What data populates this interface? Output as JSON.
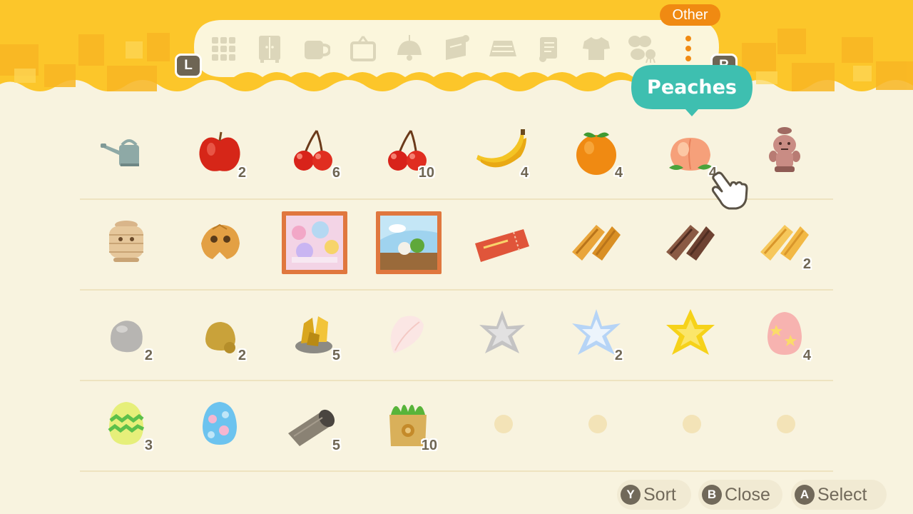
{
  "category_label": "Other",
  "tooltip_label": "Peaches",
  "shoulder_left": "L",
  "shoulder_right": "R",
  "tabs": [
    {
      "icon": "grid-icon",
      "active": false
    },
    {
      "icon": "wardrobe-icon",
      "active": false
    },
    {
      "icon": "mug-icon",
      "active": false
    },
    {
      "icon": "frame-icon",
      "active": false
    },
    {
      "icon": "lamp-icon",
      "active": false
    },
    {
      "icon": "wallpaper-icon",
      "active": false
    },
    {
      "icon": "rug-icon",
      "active": false
    },
    {
      "icon": "scroll-icon",
      "active": false
    },
    {
      "icon": "shirt-icon",
      "active": false
    },
    {
      "icon": "bug-fish-icon",
      "active": false
    },
    {
      "icon": "more-icon",
      "active": true
    }
  ],
  "inventory": [
    [
      {
        "name": "watering-can-icon",
        "qty": ""
      },
      {
        "name": "apple-icon",
        "qty": "2"
      },
      {
        "name": "cherry-icon",
        "qty": "6"
      },
      {
        "name": "cherry-icon",
        "qty": "10"
      },
      {
        "name": "banana-icon",
        "qty": "4"
      },
      {
        "name": "orange-icon",
        "qty": "4"
      },
      {
        "name": "peach-icon",
        "qty": "4"
      },
      {
        "name": "gyroid-icon",
        "qty": ""
      }
    ],
    [
      {
        "name": "wicker-gyroid-icon",
        "qty": ""
      },
      {
        "name": "gyroid-fragment-icon",
        "qty": ""
      },
      {
        "name": "painting-icon",
        "qty": ""
      },
      {
        "name": "painting-icon",
        "qty": ""
      },
      {
        "name": "ticket-icon",
        "qty": ""
      },
      {
        "name": "wood-icon",
        "qty": ""
      },
      {
        "name": "hardwood-icon",
        "qty": ""
      },
      {
        "name": "softwood-icon",
        "qty": "2"
      }
    ],
    [
      {
        "name": "stone-icon",
        "qty": "2"
      },
      {
        "name": "clay-icon",
        "qty": "2"
      },
      {
        "name": "gold-nugget-icon",
        "qty": "5"
      },
      {
        "name": "petal-icon",
        "qty": ""
      },
      {
        "name": "star-fragment-icon",
        "qty": ""
      },
      {
        "name": "star-fragment-icon",
        "qty": "2"
      },
      {
        "name": "star-fragment-icon",
        "qty": ""
      },
      {
        "name": "egg-icon",
        "qty": "4"
      }
    ],
    [
      {
        "name": "egg-icon",
        "qty": "3"
      },
      {
        "name": "egg-icon",
        "qty": ""
      },
      {
        "name": "rug-roll-icon",
        "qty": "5"
      },
      {
        "name": "turnip-bag-icon",
        "qty": "10"
      },
      {
        "name": "empty-slot",
        "qty": ""
      },
      {
        "name": "empty-slot",
        "qty": ""
      },
      {
        "name": "empty-slot",
        "qty": ""
      },
      {
        "name": "empty-slot",
        "qty": ""
      }
    ]
  ],
  "footer": [
    {
      "key": "Y",
      "label": "Sort"
    },
    {
      "key": "B",
      "label": "Close"
    },
    {
      "key": "A",
      "label": "Select"
    }
  ],
  "colors": {
    "header": "#fcc62a",
    "tabbar": "#fbf6dc",
    "accent_orange": "#f08a12",
    "tooltip_teal": "#3ebfb0",
    "background": "#f8f3df"
  }
}
